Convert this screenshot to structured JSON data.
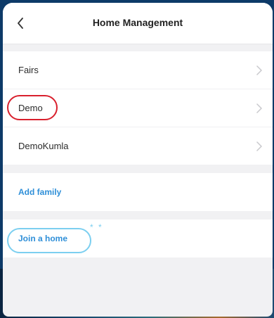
{
  "header": {
    "title": "Home Management",
    "back_icon": "chevron-left-icon"
  },
  "homes": [
    {
      "label": "Fairs"
    },
    {
      "label": "Demo"
    },
    {
      "label": "DemoKumla"
    }
  ],
  "actions": {
    "add_family": "Add family",
    "join_home": "Join a home"
  },
  "annotation": {
    "marks": "* *"
  },
  "colors": {
    "accent": "#2f8fd8",
    "highlight_red": "#d9202d",
    "highlight_blue": "#7ccff0"
  }
}
